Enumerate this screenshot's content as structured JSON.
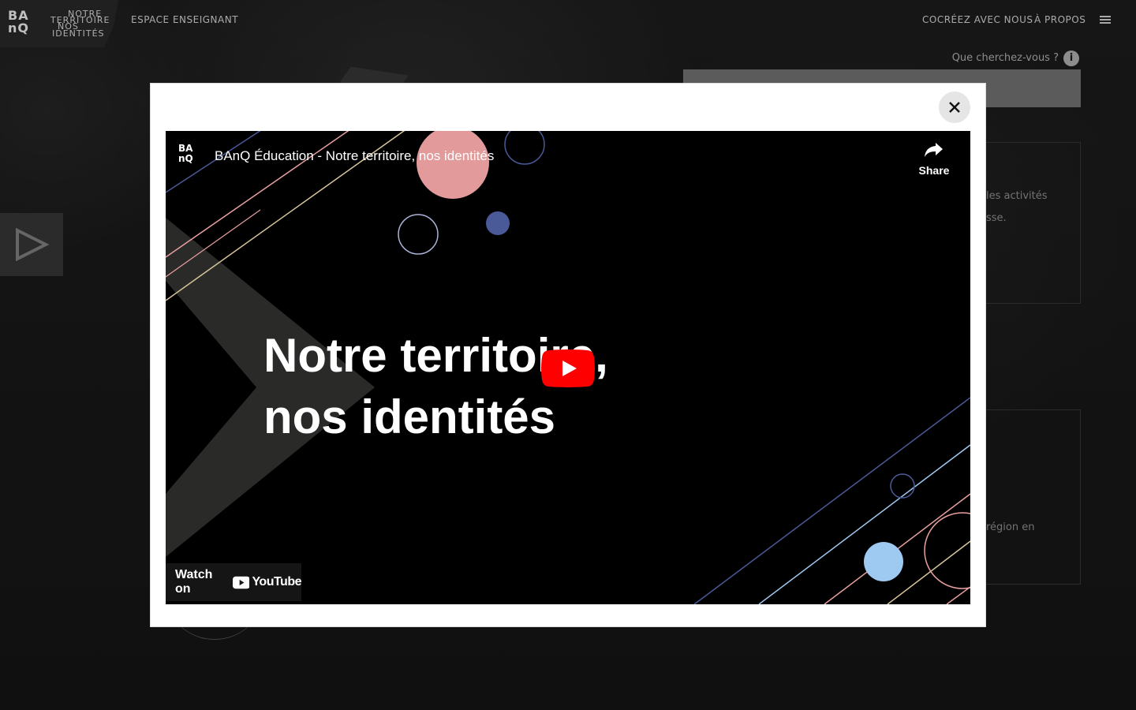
{
  "header": {
    "logo_letters": [
      "BA",
      "nQ"
    ],
    "logo_words": [
      "NOTRE",
      "TERRITOIRE",
      "NOS",
      "IDENTITÉS"
    ],
    "nav_left": "ESPACE ENSEIGNANT",
    "nav_right": [
      "COCRÉEZ AVEC NOUS",
      "À PROPOS"
    ]
  },
  "search": {
    "label": "Que cherchez-vous ?",
    "placeholder": ""
  },
  "background_cards": [
    {
      "lines": [
        "les activités",
        "sse."
      ]
    },
    {
      "lines": [
        "région en"
      ]
    }
  ],
  "modal": {
    "video": {
      "channel_logo": [
        "BA",
        "nQ"
      ],
      "title": "BAnQ Éducation - Notre territoire, nos identités",
      "share_label": "Share",
      "headline_lines": [
        "Notre territoire,",
        "nos identités"
      ],
      "watch_on_label": "Watch on",
      "youtube_label": "YouTube"
    }
  },
  "icons": {
    "close": "close-icon",
    "menu": "menu-icon",
    "info": "info-icon",
    "play": "play-icon",
    "share": "share-icon"
  },
  "colors": {
    "page_bg": "#1b1b1b",
    "video_bg": "#000000",
    "youtube_red": "#ff0000",
    "modal_bg": "#ffffff",
    "circle_pink": "#e8a0a0",
    "circle_blue": "#9ec9f0",
    "circle_navy": "#4a5a98"
  }
}
